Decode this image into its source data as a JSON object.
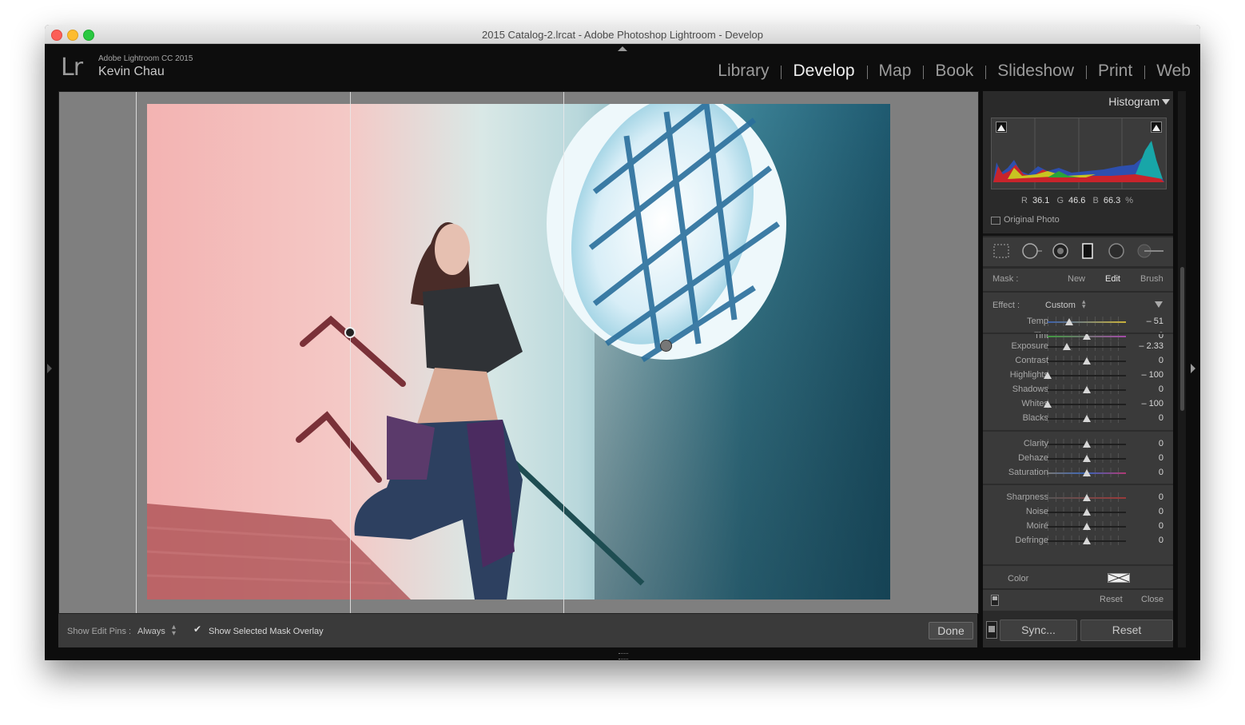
{
  "window": {
    "title": "2015 Catalog-2.lrcat - Adobe Photoshop Lightroom - Develop"
  },
  "identity": {
    "logo": "Lr",
    "app": "Adobe Lightroom CC 2015",
    "user": "Kevin Chau"
  },
  "modules": [
    {
      "label": "Library",
      "active": false
    },
    {
      "label": "Develop",
      "active": true
    },
    {
      "label": "Map",
      "active": false
    },
    {
      "label": "Book",
      "active": false
    },
    {
      "label": "Slideshow",
      "active": false
    },
    {
      "label": "Print",
      "active": false
    },
    {
      "label": "Web",
      "active": false
    }
  ],
  "toolbar": {
    "edit_pins_label": "Show Edit Pins :",
    "edit_pins_value": "Always",
    "mask_overlay_label": "Show Selected Mask Overlay",
    "mask_overlay_checked": true,
    "done_label": "Done"
  },
  "histogram": {
    "title": "Histogram",
    "r_label": "R",
    "r": "36.1",
    "g_label": "G",
    "g": "46.6",
    "b_label": "B",
    "b": "66.3",
    "percent": "%",
    "original_photo": "Original Photo"
  },
  "mask": {
    "label": "Mask :",
    "new": "New",
    "edit": "Edit",
    "brush": "Brush"
  },
  "effect": {
    "label": "Effect :",
    "value": "Custom"
  },
  "sliders": [
    {
      "group": 0,
      "label": "Temp",
      "value": "– 51",
      "pos": 0.28,
      "track": "temp"
    },
    {
      "group": 0,
      "label": "Tint",
      "value": "0",
      "pos": 0.5,
      "track": "tint"
    },
    {
      "group": 1,
      "label": "Exposure",
      "value": "– 2.33",
      "pos": 0.24,
      "track": ""
    },
    {
      "group": 1,
      "label": "Contrast",
      "value": "0",
      "pos": 0.5,
      "track": ""
    },
    {
      "group": 1,
      "label": "Highlights",
      "value": "– 100",
      "pos": 0.0,
      "track": ""
    },
    {
      "group": 1,
      "label": "Shadows",
      "value": "0",
      "pos": 0.5,
      "track": ""
    },
    {
      "group": 1,
      "label": "Whites",
      "value": "– 100",
      "pos": 0.0,
      "track": ""
    },
    {
      "group": 1,
      "label": "Blacks",
      "value": "0",
      "pos": 0.5,
      "track": ""
    },
    {
      "group": 2,
      "label": "Clarity",
      "value": "0",
      "pos": 0.5,
      "track": ""
    },
    {
      "group": 2,
      "label": "Dehaze",
      "value": "0",
      "pos": 0.5,
      "track": ""
    },
    {
      "group": 2,
      "label": "Saturation",
      "value": "0",
      "pos": 0.5,
      "track": "sat"
    },
    {
      "group": 3,
      "label": "Sharpness",
      "value": "0",
      "pos": 0.5,
      "track": "sharp"
    },
    {
      "group": 3,
      "label": "Noise",
      "value": "0",
      "pos": 0.5,
      "track": ""
    },
    {
      "group": 3,
      "label": "Moiré",
      "value": "0",
      "pos": 0.5,
      "track": ""
    },
    {
      "group": 3,
      "label": "Defringe",
      "value": "0",
      "pos": 0.5,
      "track": ""
    }
  ],
  "color": {
    "label": "Color"
  },
  "panel_footer": {
    "reset": "Reset",
    "close": "Close"
  },
  "buttons": {
    "sync": "Sync...",
    "reset": "Reset"
  }
}
